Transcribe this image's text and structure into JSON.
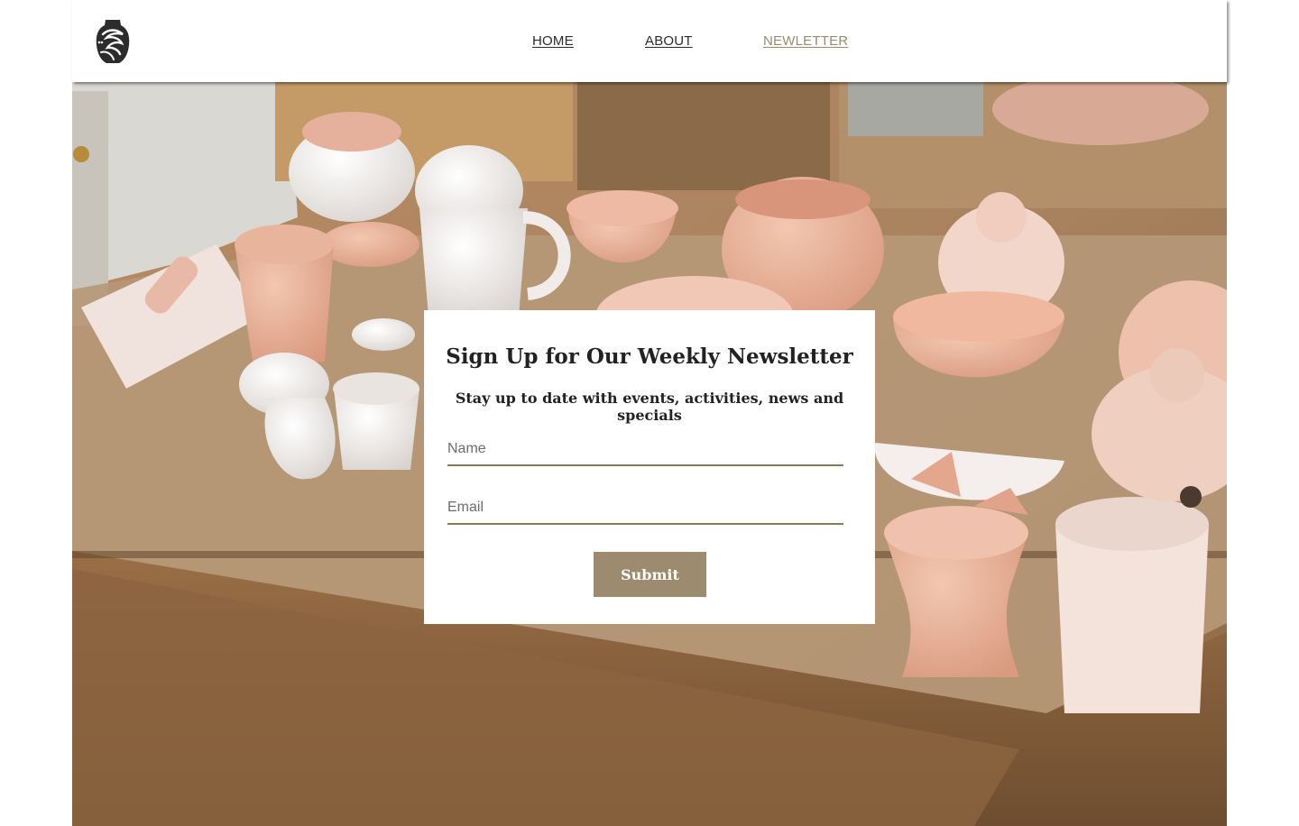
{
  "header": {
    "logo_icon": "ceramic-vase-logo-icon",
    "nav": [
      {
        "label": "HOME",
        "active": false
      },
      {
        "label": "ABOUT",
        "active": false
      },
      {
        "label": "NEWLETTER",
        "active": true
      }
    ],
    "active_color": "#9a8a6e"
  },
  "hero": {
    "image_subject": "pottery-on-workbench"
  },
  "newsletter": {
    "title": "Sign Up for Our Weekly Newsletter",
    "subtitle": "Stay up to date with events, activities, news and specials",
    "name_placeholder": "Name",
    "email_placeholder": "Email",
    "submit_label": "Submit",
    "accent_color": "#9d8b70"
  }
}
